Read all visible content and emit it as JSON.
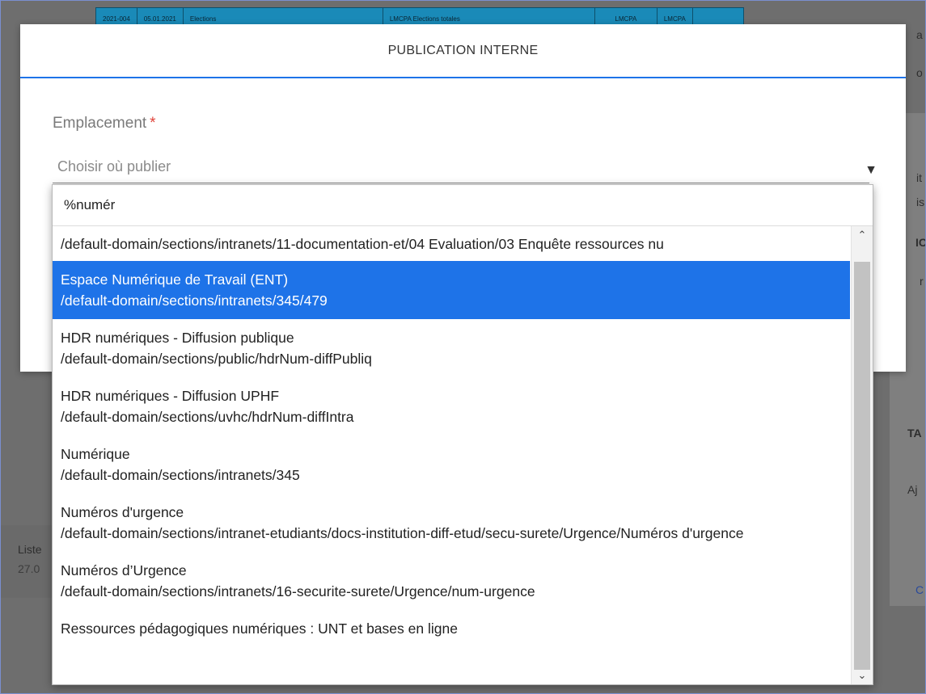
{
  "background": {
    "strip_cells": [
      "2021-004",
      "05.01.2021",
      "Elections",
      "LMCPA Elections totales",
      "LMCPA",
      "LMCPA"
    ],
    "list_label": "Liste",
    "list_date": "27.0",
    "right_snippets": [
      "a",
      "o",
      "it",
      "is",
      "IC",
      "r",
      "TA",
      "Aj",
      "C"
    ]
  },
  "modal": {
    "title": "PUBLICATION INTERNE",
    "field_label": "Emplacement",
    "required_mark": "*",
    "select_placeholder": "Choisir où publier",
    "select_arrow": "▼"
  },
  "dropdown": {
    "search_value": "%numér",
    "options": [
      {
        "title": "",
        "path": "/default-domain/sections/intranets/11-documentation-et/04 Evaluation/03 Enquête ressources nu",
        "selected": false
      },
      {
        "title": "Espace Numérique de Travail (ENT)",
        "path": "/default-domain/sections/intranets/345/479",
        "selected": true
      },
      {
        "title": "HDR numériques - Diffusion publique",
        "path": "/default-domain/sections/public/hdrNum-diffPubliq",
        "selected": false
      },
      {
        "title": "HDR numériques - Diffusion UPHF",
        "path": "/default-domain/sections/uvhc/hdrNum-diffIntra",
        "selected": false
      },
      {
        "title": "Numérique",
        "path": "/default-domain/sections/intranets/345",
        "selected": false
      },
      {
        "title": "Numéros d'urgence",
        "path": "/default-domain/sections/intranet-etudiants/docs-institution-diff-etud/secu-surete/Urgence/Numéros d'urgence",
        "selected": false
      },
      {
        "title": "Numéros d’Urgence",
        "path": "/default-domain/sections/intranets/16-securite-surete/Urgence/num-urgence",
        "selected": false
      },
      {
        "title": "Ressources pédagogiques numériques : UNT et bases en ligne",
        "path": "",
        "selected": false
      }
    ],
    "scroll_up": "⌃",
    "scroll_down": "⌄"
  }
}
